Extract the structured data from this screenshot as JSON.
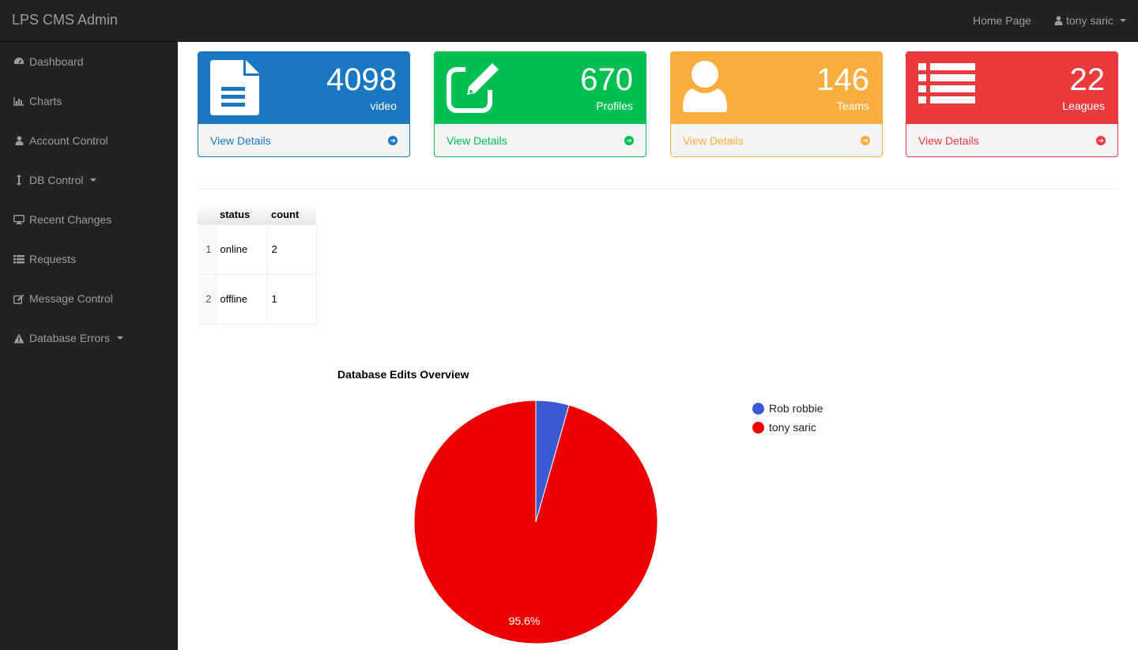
{
  "header": {
    "brand": "LPS CMS Admin",
    "home_link": "Home Page",
    "user_name": "tony saric"
  },
  "sidebar": {
    "items": [
      {
        "label": "Dashboard",
        "icon": "dashboard-icon"
      },
      {
        "label": "Charts",
        "icon": "bar-chart-icon"
      },
      {
        "label": "Account Control",
        "icon": "user-icon"
      },
      {
        "label": "DB Control",
        "icon": "vertical-arrows-icon",
        "dropdown": true
      },
      {
        "label": "Recent Changes",
        "icon": "monitor-icon"
      },
      {
        "label": "Requests",
        "icon": "list-icon"
      },
      {
        "label": "Message Control",
        "icon": "edit-icon"
      },
      {
        "label": "Database Errors",
        "icon": "warning-icon",
        "dropdown": true
      }
    ]
  },
  "panels": [
    {
      "count": "4098",
      "label": "video",
      "footer": "View Details",
      "color": "#1a77c1",
      "icon": "document-icon"
    },
    {
      "count": "670",
      "label": "Profiles",
      "footer": "View Details",
      "color": "#00c052",
      "icon": "edit-icon"
    },
    {
      "count": "146",
      "label": "Teams",
      "footer": "View Details",
      "color": "#f9ad3c",
      "icon": "user-icon"
    },
    {
      "count": "22",
      "label": "Leagues",
      "footer": "View Details",
      "color": "#ea3a3e",
      "icon": "list-icon"
    }
  ],
  "status_table": {
    "columns": [
      "status",
      "count"
    ],
    "rows": [
      {
        "n": "1",
        "status": "online",
        "count": "2"
      },
      {
        "n": "2",
        "status": "offline",
        "count": "1"
      }
    ]
  },
  "chart_data": {
    "type": "pie",
    "title": "Database Edits Overview",
    "labels": [
      "Rob robbie",
      "tony saric"
    ],
    "values": [
      4.4,
      95.6
    ],
    "colors": [
      "#3a5ad2",
      "#ee0000"
    ],
    "slice_labels": [
      "",
      "95.6%"
    ],
    "legend": "right"
  }
}
